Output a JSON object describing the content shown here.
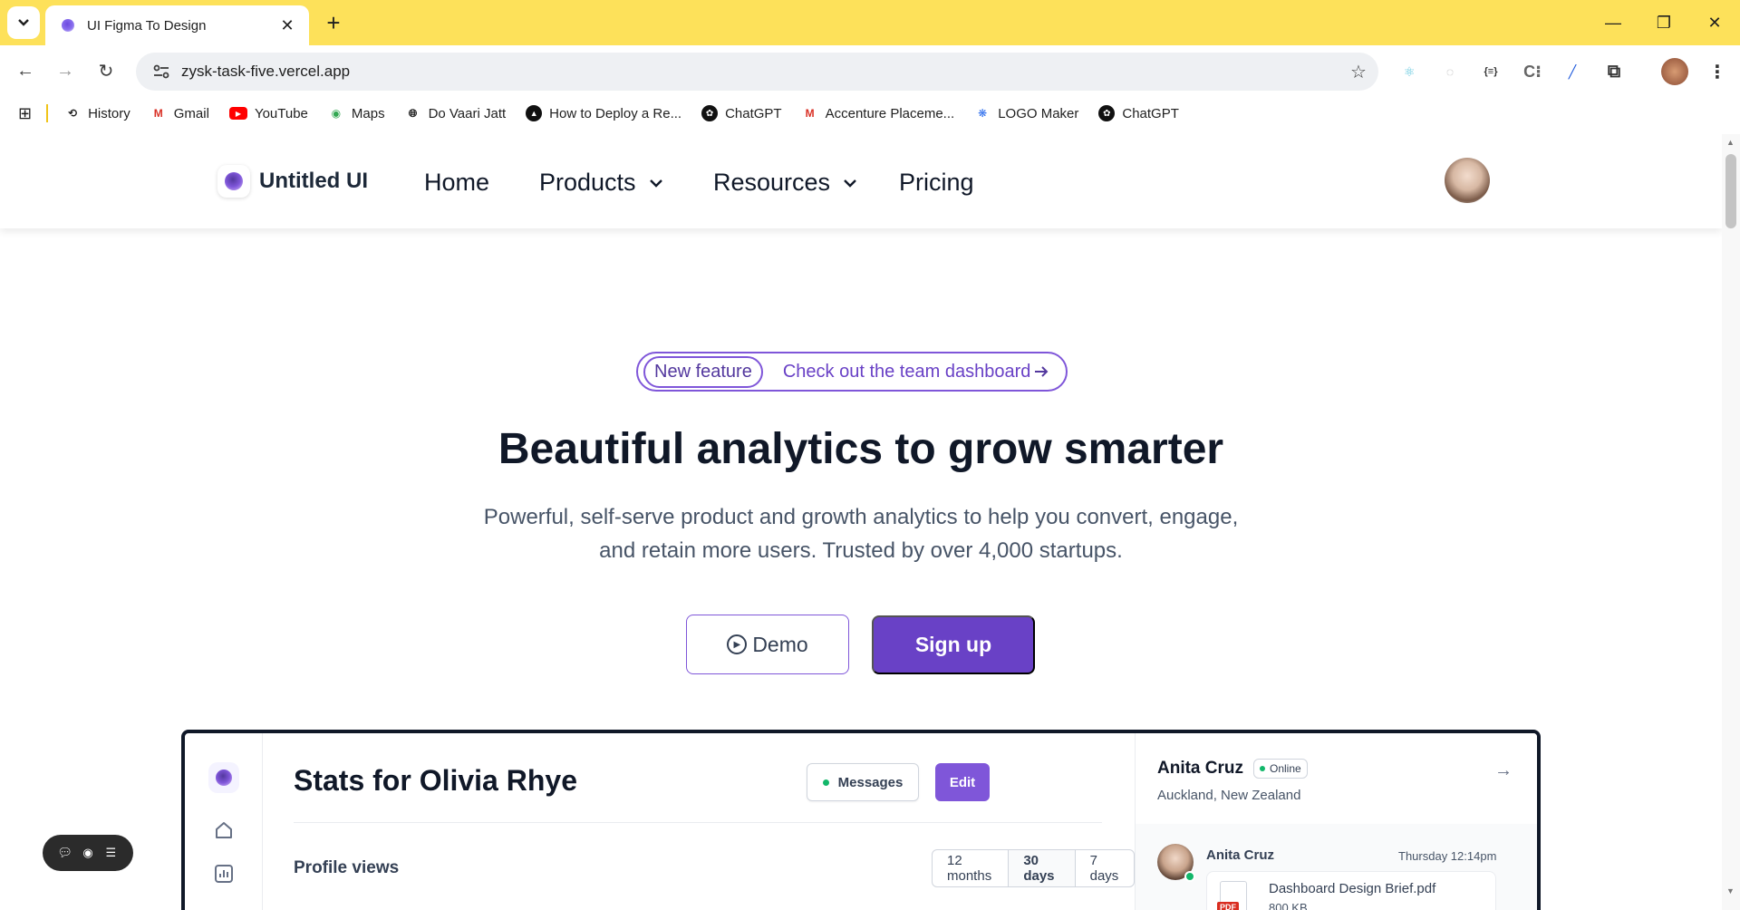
{
  "browser": {
    "tab_title": "UI Figma To Design",
    "url": "zysk-task-five.vercel.app",
    "bookmarks": [
      {
        "label": "History",
        "icon": "history-icon"
      },
      {
        "label": "Gmail",
        "icon": "gmail-icon"
      },
      {
        "label": "YouTube",
        "icon": "youtube-icon"
      },
      {
        "label": "Maps",
        "icon": "maps-icon"
      },
      {
        "label": "Do Vaari Jatt",
        "icon": "globe-icon"
      },
      {
        "label": "How to Deploy a Re...",
        "icon": "vercel-icon"
      },
      {
        "label": "ChatGPT",
        "icon": "chatgpt-icon"
      },
      {
        "label": "Accenture Placeme...",
        "icon": "gmail-icon"
      },
      {
        "label": "LOGO Maker",
        "icon": "logo-maker-icon"
      },
      {
        "label": "ChatGPT",
        "icon": "chatgpt-icon"
      }
    ]
  },
  "site": {
    "brand": "Untitled UI",
    "nav": {
      "home": "Home",
      "products": "Products",
      "resources": "Resources",
      "pricing": "Pricing"
    },
    "hero": {
      "badge_pill": "New feature",
      "badge_text": "Check out the team dashboard",
      "title": "Beautiful analytics to grow smarter",
      "subtitle_line1": "Powerful, self-serve product and growth analytics to help you convert, engage,",
      "subtitle_line2": "and retain more users. Trusted by over 4,000 startups.",
      "demo_label": "Demo",
      "signup_label": "Sign up"
    },
    "dashboard": {
      "title": "Stats for Olivia Rhye",
      "messages_label": "Messages",
      "edit_label": "Edit",
      "section_title": "Profile views",
      "ranges": [
        "12 months",
        "30 days",
        "7 days"
      ],
      "active_range": "30 days",
      "contact": {
        "name": "Anita Cruz",
        "status": "Online",
        "location": "Auckland, New Zealand"
      },
      "message": {
        "sender": "Anita Cruz",
        "time": "Thursday 12:14pm",
        "file_name": "Dashboard Design Brief.pdf",
        "file_size": "800 KB",
        "file_type": "PDF"
      }
    }
  },
  "colors": {
    "chrome_tab_strip": "#fde15a",
    "brand_purple": "#6941c6",
    "accent_purple": "#7f56d9",
    "online_green": "#12b76a"
  }
}
